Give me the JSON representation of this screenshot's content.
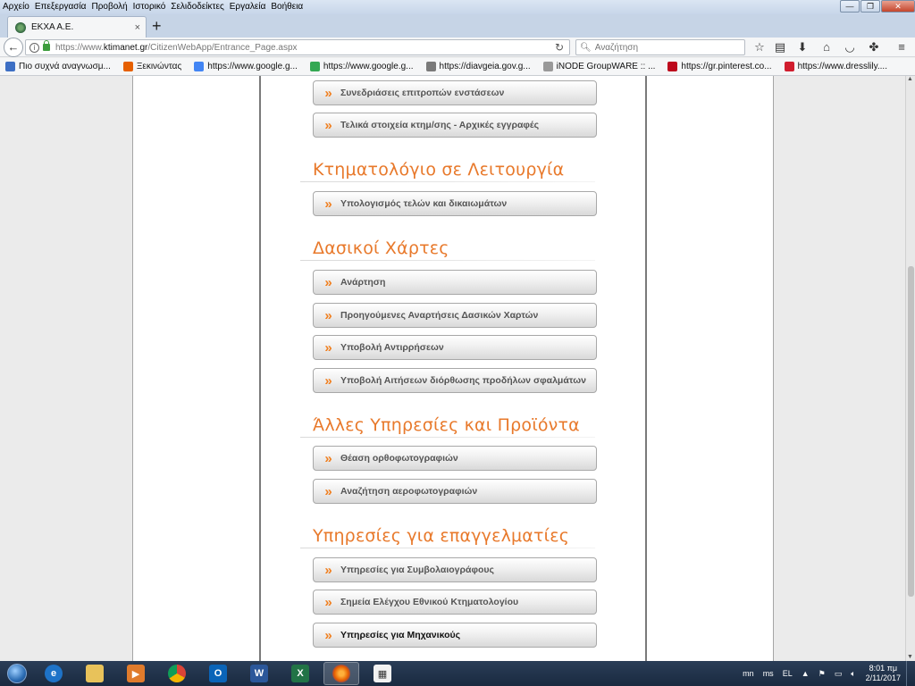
{
  "menu": [
    {
      "label": "Αρχείο"
    },
    {
      "label": "Επεξεργασία"
    },
    {
      "label": "Προβολή"
    },
    {
      "label": "Ιστορικό"
    },
    {
      "label": "Σελιδοδείκτες"
    },
    {
      "label": "Εργαλεία"
    },
    {
      "label": "Βοήθεια"
    }
  ],
  "tab": {
    "title": "ΕΚΧΑ Α.Ε.",
    "close": "×",
    "new": "+"
  },
  "address": {
    "prefix": "https://www.",
    "domain": "ktimanet.gr",
    "path": "/CitizenWebApp/Entrance_Page.aspx"
  },
  "search": {
    "placeholder": "Αναζήτηση"
  },
  "bookmarks": [
    {
      "label": "Πιο συχνά αναγνωσμ...",
      "color": "#3d6fc4"
    },
    {
      "label": "Ξεκινώντας",
      "color": "#e66000"
    },
    {
      "label": "https://www.google.g...",
      "color": "#4285f4"
    },
    {
      "label": "https://www.google.g...",
      "color": "#34a853"
    },
    {
      "label": "https://diavgeia.gov.g...",
      "color": "#7a7a7a"
    },
    {
      "label": "iNODE GroupWARE :: ...",
      "color": "#999999"
    },
    {
      "label": "https://gr.pinterest.co...",
      "color": "#bd081c"
    },
    {
      "label": "https://www.dresslily....",
      "color": "#d01d2e"
    }
  ],
  "sections": [
    {
      "title": "",
      "items": [
        "Συνεδριάσεις επιτροπών ενστάσεων",
        "Τελικά στοιχεία κτημ/σης - Αρχικές εγγραφές"
      ]
    },
    {
      "title": "Κτηματολόγιο σε Λειτουργία",
      "items": [
        "Υπολογισμός τελών και δικαιωμάτων"
      ]
    },
    {
      "title": "Δασικοί Χάρτες",
      "items": [
        "Ανάρτηση",
        "Προηγούμενες Αναρτήσεις Δασικών Χαρτών",
        "Υποβολή Αντιρρήσεων",
        "Υποβολή Αιτήσεων διόρθωσης προδήλων σφαλμάτων"
      ]
    },
    {
      "title": "Άλλες Υπηρεσίες και Προϊόντα",
      "items": [
        "Θέαση ορθοφωτογραφιών",
        "Αναζήτηση αεροφωτογραφιών"
      ]
    },
    {
      "title": "Υπηρεσίες για επαγγελματίες",
      "items": [
        "Υπηρεσίες για Συμβολαιογράφους",
        "Σημεία Ελέγχου Εθνικού Κτηματολογίου",
        "Υπηρεσίες για Μηχανικούς"
      ]
    }
  ],
  "colors": {
    "accent": "#e8792b",
    "arrow": "#f07f1f"
  },
  "taskbar": {
    "apps": [
      "internet-explorer",
      "file-explorer",
      "media-player",
      "chrome",
      "outlook",
      "word",
      "excel",
      "firefox",
      "app"
    ],
    "tray": {
      "lang1": "mn",
      "lang2": "ms",
      "lang": "EL",
      "time": "8:01 πμ",
      "date": "2/11/2017"
    }
  }
}
